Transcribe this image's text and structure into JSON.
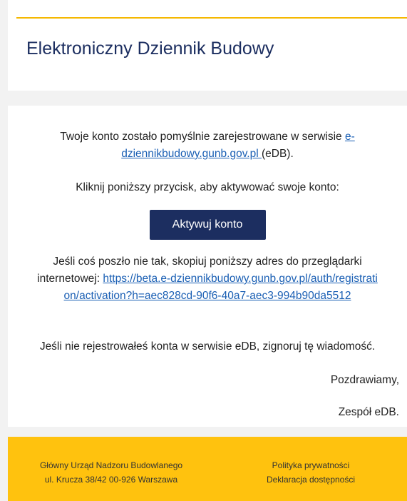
{
  "header": {
    "title": "Elektroniczny Dziennik Budowy"
  },
  "message": {
    "para1_before": "Twoje konto zostało pomyślnie zarejestrowane w serwisie ",
    "para1_link": "e-dziennikbudowy.gunb.gov.pl ",
    "para1_after": "(eDB).",
    "para2": "Kliknij poniższy przycisk, aby aktywować swoje konto:",
    "activate_button": "Aktywuj konto",
    "para3_before": "Jeśli coś poszło nie tak, skopiuj poniższy adres do przeglądarki internetowej: ",
    "para3_link": "https://beta.e-dziennikbudowy.gunb.gov.pl/auth/registration/activation?h=aec828cd-90f6-40a7-aec3-994b90da5512",
    "para4": "Jeśli nie rejestrowałeś konta w serwisie eDB, zignoruj tę wiadomość.",
    "sign_greeting": "Pozdrawiamy,",
    "sign_team": "Zespół eDB."
  },
  "footer": {
    "org_name": "Główny Urząd Nadzoru Budowlanego",
    "org_address": "ul. Krucza 38/42 00-926 Warszawa",
    "privacy_link": "Polityka prywatności",
    "accessibility_link": "Deklaracja dostępności"
  },
  "colors": {
    "brand_navy": "#1c2e60",
    "accent_yellow": "#ffc20e",
    "link_blue": "#1a5fb4"
  }
}
